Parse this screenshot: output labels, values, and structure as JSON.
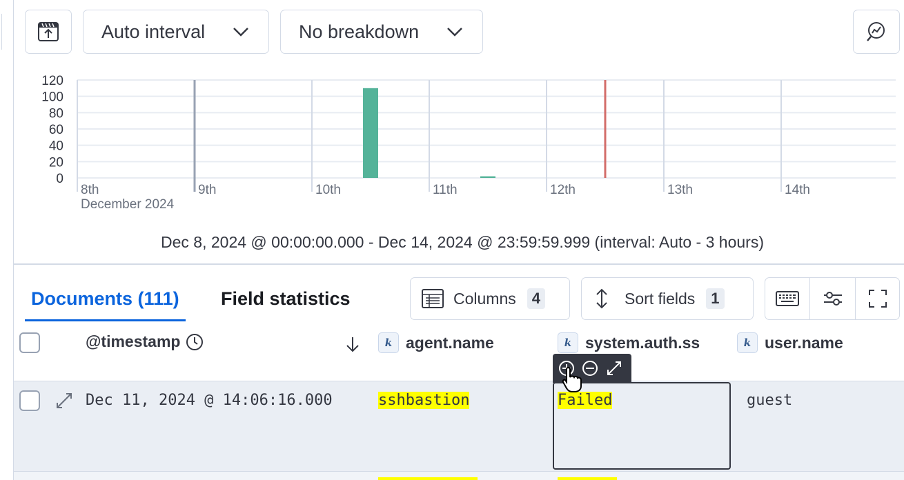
{
  "toolbar": {
    "interval_label": "Auto interval",
    "breakdown_label": "No breakdown"
  },
  "chart_data": {
    "type": "bar",
    "y_ticks": [
      120,
      100,
      80,
      60,
      40,
      20,
      0
    ],
    "ylim": [
      0,
      120
    ],
    "x_ticks": [
      "8th",
      "9th",
      "10th",
      "11th",
      "12th",
      "13th",
      "14th"
    ],
    "x_sublabel": "December 2024",
    "bars": [
      {
        "x_day": 2.5,
        "value": 110
      },
      {
        "x_day": 3.5,
        "value": 2
      }
    ],
    "marker_x_day": 4.5,
    "colors": {
      "bar": "#54b399",
      "marker": "#d36d6a",
      "grid": "#e8ecf2"
    },
    "range_text": "Dec 8, 2024 @ 00:00:00.000 - Dec 14, 2024 @ 23:59:59.999 (interval: Auto - 3 hours)"
  },
  "tabs": {
    "documents": "Documents (111)",
    "field_statistics": "Field statistics"
  },
  "controls": {
    "columns_label": "Columns",
    "columns_count": "4",
    "sort_label": "Sort fields",
    "sort_count": "1"
  },
  "table": {
    "headers": {
      "timestamp": "@timestamp",
      "agent": "agent.name",
      "system_auth": "system.auth.ss",
      "user": "user.name"
    },
    "type_token": "k",
    "rows": [
      {
        "timestamp": "Dec 11, 2024 @ 14:06:16.000",
        "agent": "sshbastion",
        "system_auth": "Failed",
        "user": "guest"
      }
    ]
  },
  "icons": {
    "save": "save-icon",
    "inspect": "visualization-inspect-icon",
    "columns": "table-icon",
    "sort": "sort-arrows-icon",
    "keyboard": "keyboard-icon",
    "settings": "sliders-icon",
    "fullscreen": "fullscreen-icon",
    "expand": "expand-icon",
    "clock": "clock-icon",
    "sort_dir": "arrow-down-icon",
    "zoom_in": "plus-circle-icon",
    "zoom_out": "minus-circle-icon",
    "pop_out": "expand-diagonal-icon",
    "cursor": "hand-cursor-icon"
  }
}
